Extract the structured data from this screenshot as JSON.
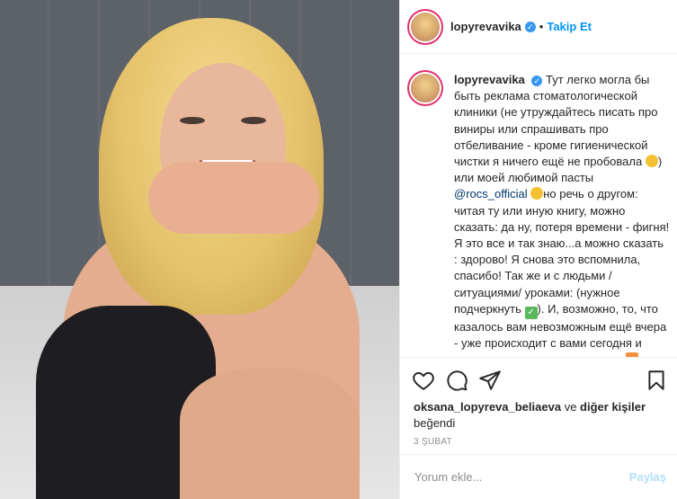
{
  "header": {
    "username": "lopyrevavika",
    "separator": "•",
    "follow_label": "Takip Et"
  },
  "caption": {
    "username": "lopyrevavika",
    "text_1": "Тут легко могла бы быть реклама стоматологической клиники (не утруждайтесь писать про виниры или спрашивать про отбеливание - кроме гигиенической чистки я ничего ещё не пробовала",
    "text_2": ") или моей любимой пасты",
    "mention": "@rocs_official",
    "text_3": "но речь о другом: читая ту или иную книгу, можно сказать: да ну, потеря времени - фигня! Я это все и так знаю...а можно сказать : здорово! Я снова это вспомнила, спасибо! Так же и с людьми / ситуациями/ уроками: (нужное подчеркнуть",
    "text_4": "). И, возможно, то, что казалось вам невозможным ещё вчера - уже происходит с вами сегодня и виновник всего этого - вы сами",
    "text_5": "."
  },
  "icons": {
    "verified": "verified-badge-icon",
    "like": "heart-icon",
    "comment": "comment-icon",
    "share": "paper-plane-icon",
    "save": "bookmark-icon"
  },
  "likes": {
    "liker": "oksana_lopyreva_beliaeva",
    "connector": "ve",
    "others": "diğer kişiler",
    "verb": "beğendi"
  },
  "date": "3 ŞUBAT",
  "comment": {
    "placeholder": "Yorum ekle...",
    "post_label": "Paylaş"
  },
  "colors": {
    "accent": "#0095f6",
    "post_disabled": "#b2dffc",
    "text": "#262626",
    "muted": "#8e8e8e"
  }
}
